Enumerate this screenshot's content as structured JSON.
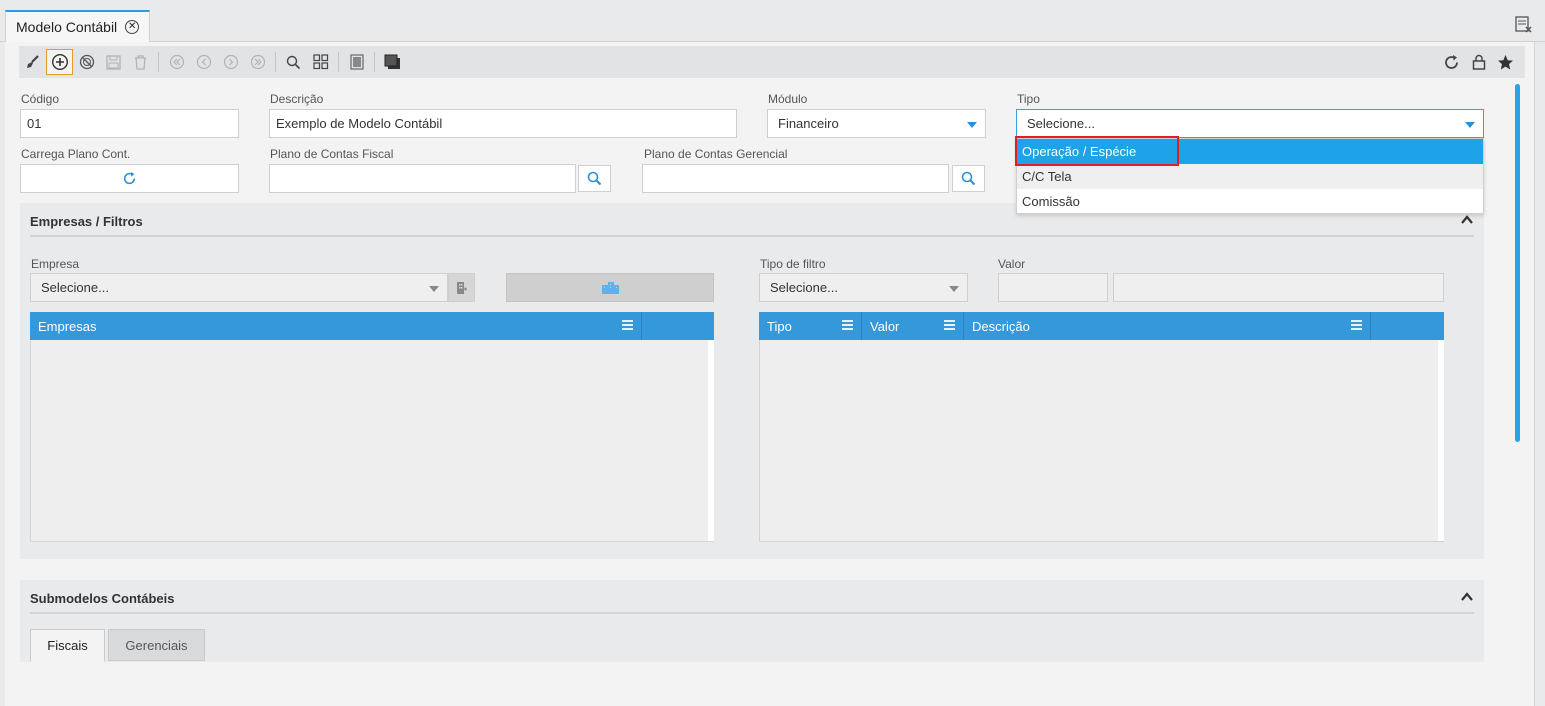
{
  "tab": {
    "title": "Modelo Contábil"
  },
  "toolbar": {
    "buttons": [
      "brush-icon",
      "add-icon",
      "cancel-icon",
      "save-icon",
      "delete-icon",
      "first-icon",
      "prev-icon",
      "next-icon",
      "last-icon",
      "search-icon",
      "grid-icon",
      "report-icon",
      "layers-icon"
    ],
    "right_buttons": [
      "refresh-icon",
      "lock-icon",
      "star-icon"
    ]
  },
  "form": {
    "codigo": {
      "label": "Código",
      "value": "01"
    },
    "descricao": {
      "label": "Descrição",
      "value": "Exemplo de Modelo Contábil"
    },
    "modulo": {
      "label": "Módulo",
      "value": "Financeiro"
    },
    "tipo": {
      "label": "Tipo",
      "placeholder": "Selecione...",
      "options": [
        "Operação / Espécie",
        "C/C Tela",
        "Comissão"
      ],
      "highlighted": "Operação / Espécie"
    },
    "carrega": {
      "label": "Carrega Plano Cont."
    },
    "plano_fiscal": {
      "label": "Plano de Contas Fiscal",
      "value": ""
    },
    "plano_gerencial": {
      "label": "Plano de Contas Gerencial",
      "value": ""
    }
  },
  "empresas_filtros": {
    "title": "Empresas / Filtros",
    "empresa": {
      "label": "Empresa",
      "placeholder": "Selecione..."
    },
    "tipo_filtro": {
      "label": "Tipo de filtro",
      "placeholder": "Selecione..."
    },
    "valor": {
      "label": "Valor"
    },
    "grid_empresas": {
      "columns": [
        "Empresas"
      ]
    },
    "grid_filtros": {
      "columns": [
        "Tipo",
        "Valor",
        "Descrição"
      ]
    }
  },
  "submodelos": {
    "title": "Submodelos Contábeis",
    "tabs": [
      "Fiscais",
      "Gerenciais"
    ],
    "active_tab": "Fiscais"
  },
  "colors": {
    "accent": "#3498db",
    "dropdown_selected": "#1fa3e8",
    "highlight": "#e02020",
    "active_button": "#e89a2b"
  }
}
